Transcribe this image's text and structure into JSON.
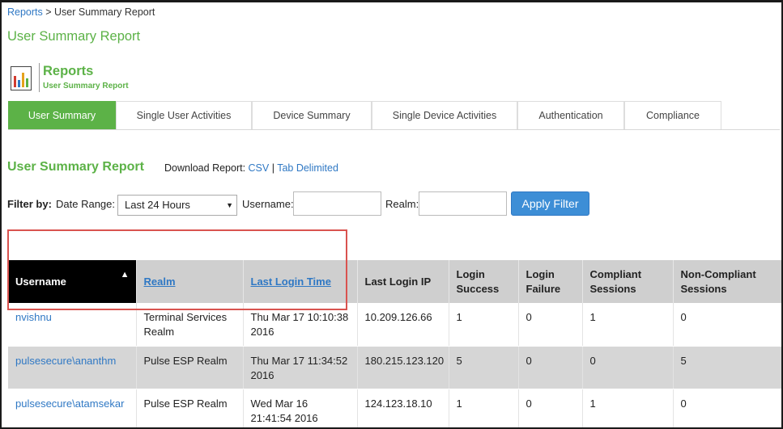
{
  "breadcrumb": {
    "root": "Reports",
    "separator": " > ",
    "current": "User Summary Report"
  },
  "page_title": "User Summary Report",
  "reports_header": {
    "title": "Reports",
    "subtitle": "User Summary Report",
    "icon": "report-chart-icon"
  },
  "tabs": [
    {
      "label": "User Summary",
      "active": true
    },
    {
      "label": "Single User Activities",
      "active": false
    },
    {
      "label": "Device Summary",
      "active": false
    },
    {
      "label": "Single Device Activities",
      "active": false
    },
    {
      "label": "Authentication",
      "active": false
    },
    {
      "label": "Compliance",
      "active": false
    }
  ],
  "section": {
    "title": "User Summary Report",
    "download_label": "Download Report: ",
    "csv_link": "CSV",
    "divider": " | ",
    "tab_delimited_link": "Tab Delimited"
  },
  "filter": {
    "filter_by": "Filter by:",
    "date_range_label": "Date Range:",
    "date_range_value": "Last 24 Hours",
    "username_label": "Username:",
    "username_value": "",
    "realm_label": "Realm:",
    "realm_value": "",
    "apply_button": "Apply Filter"
  },
  "table": {
    "columns": [
      {
        "label": "Username",
        "sortable": true,
        "sorted": "asc"
      },
      {
        "label": "Realm",
        "sortable": true
      },
      {
        "label": "Last Login Time",
        "sortable": true
      },
      {
        "label": "Last Login IP",
        "sortable": false
      },
      {
        "label": "Login Success",
        "sortable": false
      },
      {
        "label": "Login Failure",
        "sortable": false
      },
      {
        "label": "Compliant Sessions",
        "sortable": false
      },
      {
        "label": "Non-Compliant Sessions",
        "sortable": false
      }
    ],
    "rows": [
      {
        "username": "nvishnu",
        "realm": "Terminal Services Realm",
        "last_login_time": "Thu Mar 17 10:10:38 2016",
        "last_login_ip": "10.209.126.66",
        "login_success": "1",
        "login_failure": "0",
        "compliant": "1",
        "non_compliant": "0"
      },
      {
        "username": "pulsesecure\\ananthm",
        "realm": "Pulse ESP Realm",
        "last_login_time": "Thu Mar 17 11:34:52 2016",
        "last_login_ip": "180.215.123.120",
        "login_success": "5",
        "login_failure": "0",
        "compliant": "0",
        "non_compliant": "5"
      },
      {
        "username": "pulsesecure\\atamsekar",
        "realm": "Pulse ESP Realm",
        "last_login_time": "Wed Mar 16 21:41:54 2016",
        "last_login_ip": "124.123.18.10",
        "login_success": "1",
        "login_failure": "0",
        "compliant": "1",
        "non_compliant": "0"
      }
    ]
  },
  "colors": {
    "accent_green": "#5cb247",
    "link_blue": "#2f78c4",
    "highlight_red": "#d9534f",
    "button_blue": "#3d8ed6"
  }
}
